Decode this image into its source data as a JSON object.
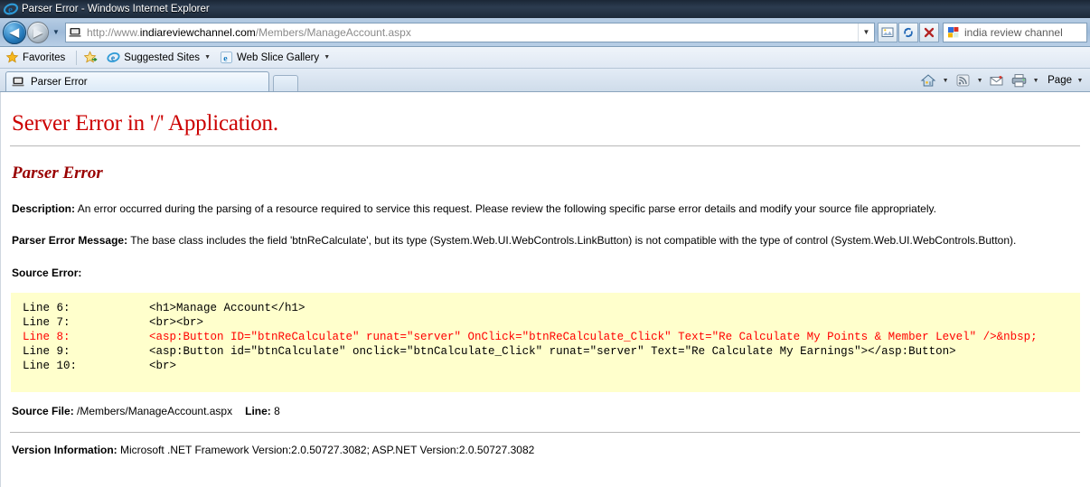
{
  "window": {
    "title": "Parser Error - Windows Internet Explorer",
    "app_icon": "ie-logo-icon"
  },
  "navbar": {
    "back_label": "◀",
    "forward_label": "▶",
    "history_caret": "▼",
    "address_protocol": "http://www.",
    "address_host": "indiareviewchannel.com",
    "address_path": "/Members/ManageAccount.aspx",
    "address_full": "http://www.indiareviewchannel.com/Members/ManageAccount.aspx",
    "address_caret": "▼",
    "compat_icon": "compatibility-view-icon",
    "refresh_icon": "refresh-icon",
    "stop_icon": "stop-icon",
    "search_value": "india review channel",
    "search_provider_icon": "google-icon"
  },
  "favorites_bar": {
    "favorites_label": "Favorites",
    "add_favorite_icon": "add-to-favorites-icon",
    "suggested_sites_label": "Suggested Sites",
    "web_slice_label": "Web Slice Gallery",
    "caret": "▼"
  },
  "tabs": {
    "items": [
      {
        "label": "Parser Error",
        "icon": "page-icon",
        "active": true
      }
    ],
    "new_tab_label": ""
  },
  "command_bar": {
    "home_icon": "home-icon",
    "feeds_icon": "rss-feed-icon",
    "mail_icon": "mail-icon",
    "print_icon": "printer-icon",
    "page_label": "Page",
    "caret": "▼"
  },
  "content": {
    "heading": "Server Error in '/' Application.",
    "subheading": "Parser Error",
    "description_label": "Description:",
    "description_text": " An error occurred during the parsing of a resource required to service this request. Please review the following specific parse error details and modify your source file appropriately.",
    "parser_error_label": "Parser Error Message:",
    "parser_error_text": " The base class includes the field 'btnReCalculate', but its type (System.Web.UI.WebControls.LinkButton) is not compatible with the type of control (System.Web.UI.WebControls.Button).",
    "source_error_label": "Source Error:",
    "code_lines": [
      {
        "number": "Line 6:",
        "code": "<h1>Manage Account</h1>",
        "highlight": false
      },
      {
        "number": "Line 7:",
        "code": "<br><br>",
        "highlight": false
      },
      {
        "number": "Line 8:",
        "code": "<asp:Button ID=\"btnReCalculate\" runat=\"server\" OnClick=\"btnReCalculate_Click\" Text=\"Re Calculate My Points & Member Level\" />&nbsp;",
        "highlight": true
      },
      {
        "number": "Line 9:",
        "code": "<asp:Button id=\"btnCalculate\" onclick=\"btnCalculate_Click\" runat=\"server\" Text=\"Re Calculate My Earnings\"></asp:Button>",
        "highlight": false
      },
      {
        "number": "Line 10:",
        "code": "<br>",
        "highlight": false
      }
    ],
    "source_file_label": "Source File:",
    "source_file_value": " /Members/ManageAccount.aspx",
    "line_label": "Line:",
    "line_value": " 8",
    "version_label": "Version Information:",
    "version_text": " Microsoft .NET Framework Version:2.0.50727.3082; ASP.NET Version:2.0.50727.3082"
  },
  "colors": {
    "error_red": "#cc0000",
    "parser_dark_red": "#990000",
    "code_highlight": "#ff0000",
    "code_bg": "#ffffcc"
  }
}
